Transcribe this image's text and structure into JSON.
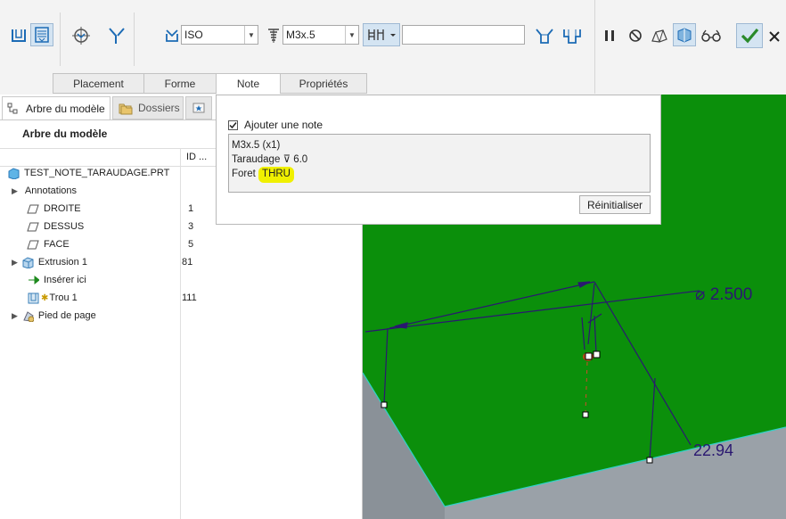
{
  "toolbar": {
    "standard_value": "ISO",
    "screw_size_value": "M3x.5",
    "depth_field_value": ""
  },
  "tabs": [
    {
      "label": "Placement"
    },
    {
      "label": "Forme"
    },
    {
      "label": "Note"
    },
    {
      "label": "Propriétés"
    }
  ],
  "left_panel": {
    "tab_model_tree": "Arbre du modèle",
    "tab_folders": "Dossiers",
    "heading": "Arbre du modèle",
    "column_id": "ID ...",
    "items": [
      {
        "label": "TEST_NOTE_TARAUDAGE.PRT",
        "id": ""
      },
      {
        "label": "Annotations",
        "id": ""
      },
      {
        "label": "DROITE",
        "id": "1"
      },
      {
        "label": "DESSUS",
        "id": "3"
      },
      {
        "label": "FACE",
        "id": "5"
      },
      {
        "label": "Extrusion 1",
        "id": "81"
      },
      {
        "label": "Insérer ici",
        "id": ""
      },
      {
        "label": "Trou 1",
        "id": "111"
      },
      {
        "label": "Pied de page",
        "id": ""
      }
    ]
  },
  "note_panel": {
    "checkbox_label": "Ajouter une note",
    "checked": true,
    "line1": "M3x.5 (x1)",
    "line2_prefix": "Taraudage",
    "line2_symbol": "⊽",
    "line2_value": "6.0",
    "line3_prefix": "Foret",
    "line3_value": "THRU",
    "reset_label": "Réinitialiser"
  },
  "viewport": {
    "dim_diameter": "⌀ 2.500",
    "dim_length": "22.94",
    "colors": {
      "face": "#0b8f0b",
      "side": "#8a9198",
      "dim": "#2a1870"
    }
  },
  "colors": {
    "accent": "#1c6bb5",
    "confirm": "#2a8a2a",
    "highlight": "#f0f000"
  }
}
